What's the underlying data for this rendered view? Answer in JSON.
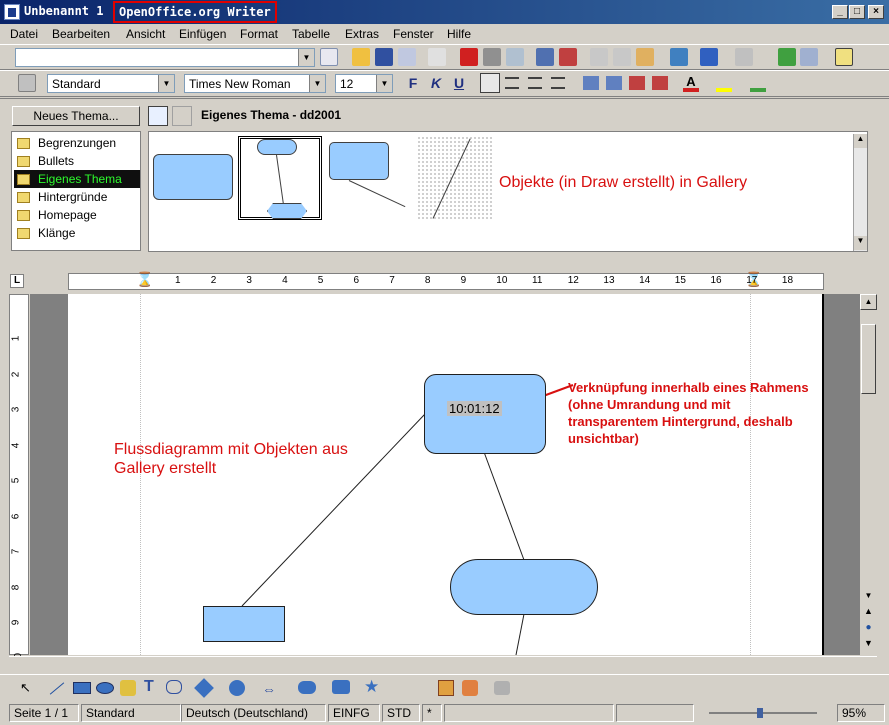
{
  "window": {
    "doc_name": "Unbenannt 1",
    "app_name": "OpenOffice.org Writer",
    "btn_min": "_",
    "btn_max": "□",
    "btn_close": "×"
  },
  "menu": [
    "Datei",
    "Bearbeiten",
    "Ansicht",
    "Einfügen",
    "Format",
    "Tabelle",
    "Extras",
    "Fenster",
    "Hilfe"
  ],
  "format_toolbar": {
    "style": "Standard",
    "font": "Times New Roman",
    "size": "12",
    "bold": "F",
    "italic": "K",
    "underline": "U"
  },
  "gallery": {
    "new_theme_button": "Neues Thema...",
    "current_theme": "Eigenes Thema - dd2001",
    "themes": [
      "Begrenzungen",
      "Bullets",
      "Eigenes Thema",
      "Hintergründe",
      "Homepage",
      "Klänge"
    ],
    "selected_theme_index": 2,
    "annotation": "Objekte (in Draw erstellt) in Gallery"
  },
  "ruler": {
    "ticks": [
      "1",
      "2",
      "3",
      "4",
      "5",
      "6",
      "7",
      "8",
      "9",
      "10",
      "11",
      "12",
      "13",
      "14",
      "15",
      "16",
      "17",
      "18"
    ],
    "left_ticks": [
      "1",
      "2",
      "3",
      "4",
      "5",
      "6",
      "7",
      "8",
      "9",
      "10"
    ]
  },
  "document": {
    "time_field": "10:01:12",
    "annotation_left": "Flussdiagramm mit Objekten aus Gallery erstellt",
    "annotation_right": "Verknüpfung innerhalb eines Rahmens (ohne Umrandung und mit transparentem Hintergrund, deshalb unsichtbar)"
  },
  "status": {
    "page": "Seite 1 / 1",
    "style": "Standard",
    "language": "Deutsch (Deutschland)",
    "insert_mode": "EINFG",
    "selection_mode": "STD",
    "modified": "*",
    "zoom": "95%"
  },
  "colors": {
    "shape_fill": "#99ccff",
    "annotation_red": "#d81010",
    "selected_theme_fg": "#2dfa2d"
  }
}
